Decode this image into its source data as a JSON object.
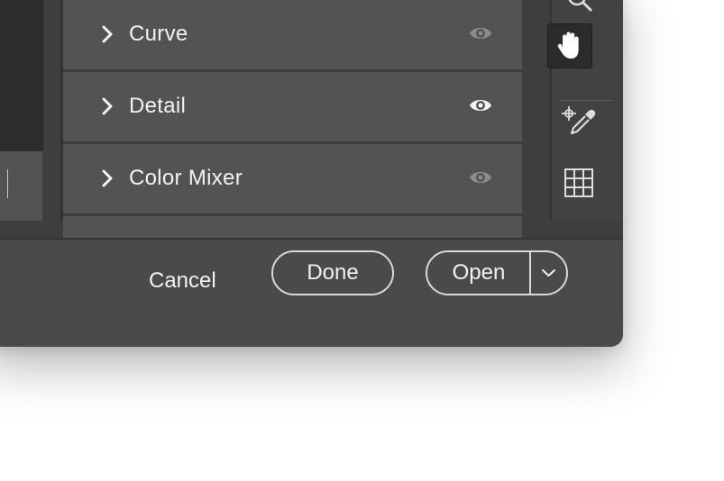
{
  "sections": [
    {
      "label": "Curve",
      "eye_state": "dim"
    },
    {
      "label": "Detail",
      "eye_state": "bright"
    },
    {
      "label": "Color Mixer",
      "eye_state": "dim"
    }
  ],
  "footer": {
    "cancel_label": "Cancel",
    "done_label": "Done",
    "open_label": "Open"
  },
  "tools": [
    "zoom-tool",
    "hand-tool",
    "color-sampler-tool",
    "grid-overlay-tool"
  ],
  "colors": {
    "panel_bg": "#535353",
    "window_bg": "#3e3e3e",
    "footer_bg": "#4a4a4a",
    "text": "#f2f2f2",
    "eye_dim": "#8c8c8c",
    "eye_bright": "#f2f2f2"
  }
}
